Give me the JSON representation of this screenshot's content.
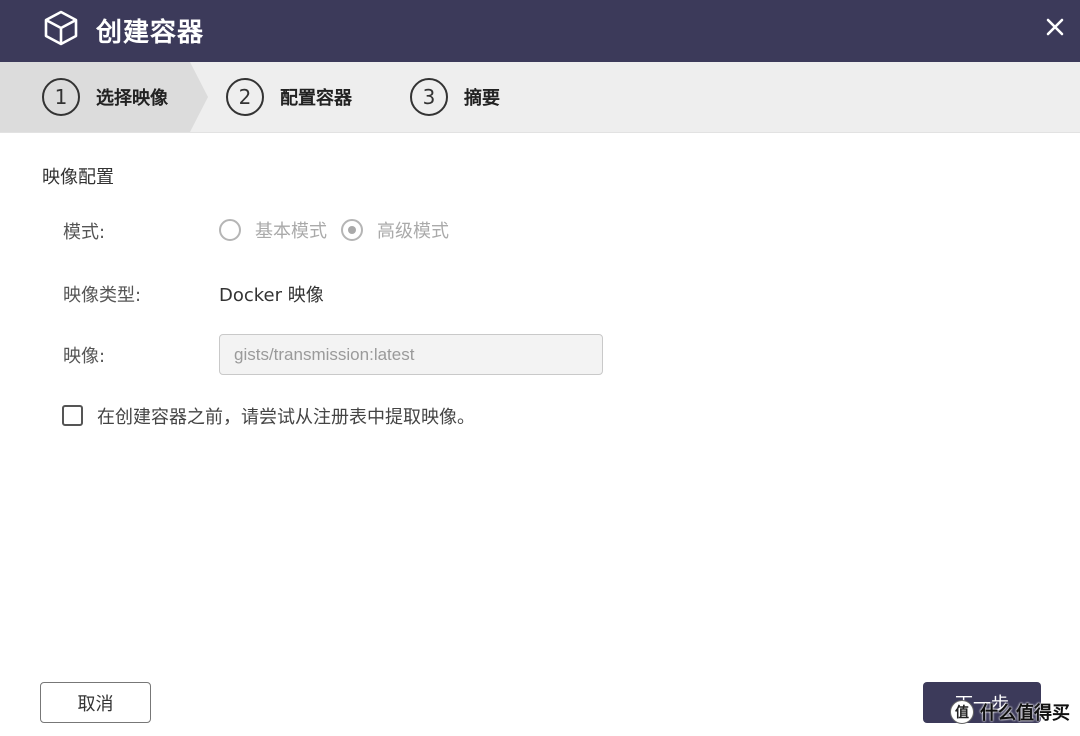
{
  "window": {
    "title": "创建容器",
    "icon": "cube-icon",
    "close_icon": "close-icon"
  },
  "stepper": {
    "steps": [
      {
        "number": "1",
        "label": "选择映像",
        "active": true
      },
      {
        "number": "2",
        "label": "配置容器",
        "active": false
      },
      {
        "number": "3",
        "label": "摘要",
        "active": false
      }
    ]
  },
  "form": {
    "section_title": "映像配置",
    "mode": {
      "label": "模式:",
      "options": [
        {
          "label": "基本模式",
          "checked": false
        },
        {
          "label": "高级模式",
          "checked": true
        }
      ],
      "disabled": true
    },
    "image_type": {
      "label": "映像类型:",
      "value": "Docker 映像"
    },
    "image": {
      "label": "映像:",
      "value": "gists/transmission:latest"
    },
    "pull_checkbox": {
      "label": "在创建容器之前，请尝试从注册表中提取映像。",
      "checked": false
    }
  },
  "footer": {
    "cancel_label": "取消",
    "next_label": "下一步"
  },
  "watermark": {
    "logo": "值",
    "text": "什么值得买"
  },
  "colors": {
    "titlebar": "#3c3a5a",
    "stepper_bg": "#eeeeee",
    "stepper_active_bg": "#dcdcdc",
    "primary_button": "#3c3a5a"
  }
}
